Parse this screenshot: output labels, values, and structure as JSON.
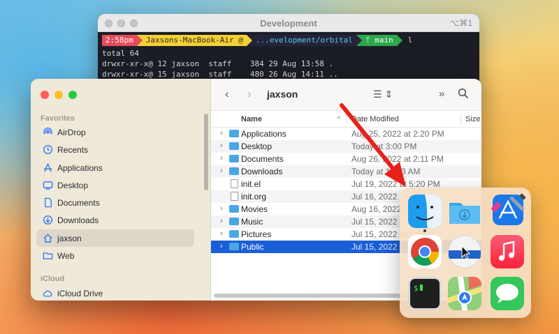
{
  "terminal": {
    "title": "Development",
    "shortcut": "⌥⌘1",
    "prompt": {
      "time": "2:58pm",
      "host": "Jaxsons-MacBook-Air @",
      "path": "...evelopment/orbital",
      "branch": "main",
      "command": "l"
    },
    "lines": [
      "total 64",
      "drwxr-xr-x@ 12 jaxson  staff    384 29 Aug 13:58 .",
      "drwxr-xr-x@ 15 jaxson  staff    480 26 Aug 14:11 .."
    ]
  },
  "finder": {
    "sidebar": {
      "favorites_label": "Favorites",
      "items": [
        {
          "label": "AirDrop",
          "icon": "airdrop-icon"
        },
        {
          "label": "Recents",
          "icon": "clock-icon"
        },
        {
          "label": "Applications",
          "icon": "applications-icon"
        },
        {
          "label": "Desktop",
          "icon": "desktop-icon"
        },
        {
          "label": "Documents",
          "icon": "document-icon"
        },
        {
          "label": "Downloads",
          "icon": "download-icon"
        },
        {
          "label": "jaxson",
          "icon": "home-icon"
        },
        {
          "label": "Web",
          "icon": "folder-icon"
        }
      ],
      "icloud_label": "iCloud",
      "icloud_items": [
        {
          "label": "iCloud Drive",
          "icon": "cloud-icon"
        }
      ]
    },
    "toolbar": {
      "title": "jaxson"
    },
    "columns": {
      "name": "Name",
      "date": "Date Modified",
      "size": "Size"
    },
    "files": [
      {
        "name": "Applications",
        "date": "Aug 25, 2022 at 2:20 PM",
        "type": "folder"
      },
      {
        "name": "Desktop",
        "date": "Today at 3:00 PM",
        "type": "folder"
      },
      {
        "name": "Documents",
        "date": "Aug 26, 2022 at 2:11 PM",
        "type": "folder"
      },
      {
        "name": "Downloads",
        "date": "Today at 11:53 AM",
        "type": "folder"
      },
      {
        "name": "init.el",
        "date": "Jul 19, 2022 at 5:20 PM",
        "type": "file"
      },
      {
        "name": "init.org",
        "date": "Jul 16, 2022",
        "type": "file"
      },
      {
        "name": "Movies",
        "date": "Aug 16, 2022",
        "type": "folder"
      },
      {
        "name": "Music",
        "date": "Jul 15, 2022",
        "type": "folder"
      },
      {
        "name": "Pictures",
        "date": "Jul 15, 2022 at 1:46",
        "type": "folder"
      },
      {
        "name": "Public",
        "date": "Jul 15, 2022",
        "type": "folder",
        "selected": true
      }
    ]
  },
  "app_folder": {
    "apps": [
      "finder-icon",
      "downloads-folder-icon",
      "xcode-beta-icon",
      "chrome-icon",
      "blank-app-icon",
      "music-icon",
      "terminal-icon",
      "maps-icon",
      "messages-icon"
    ]
  },
  "colors": {
    "selection": "#1a5fd6",
    "accent": "#3478f6",
    "arrow": "#e8211b"
  }
}
